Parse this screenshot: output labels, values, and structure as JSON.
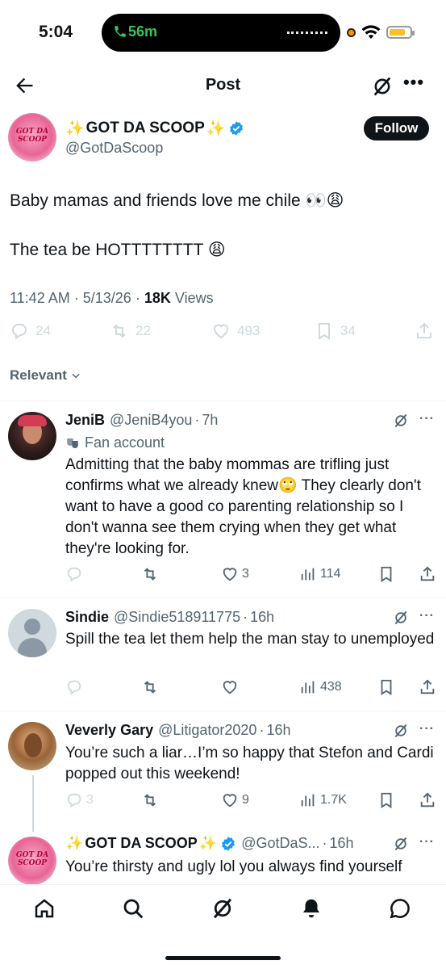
{
  "status_bar": {
    "time": "5:04",
    "call_duration": "56m",
    "battery_percent": 80,
    "accent_call": "#34c759",
    "battery_color": "#f6c026"
  },
  "header": {
    "title": "Post",
    "back_icon": "arrow-left-icon",
    "grok_icon": "grok-icon",
    "more_icon": "more-horizontal-icon"
  },
  "post": {
    "author_name": "GOT DA SCOOP",
    "sparkle": "✨",
    "handle": "@GotDaScoop",
    "avatar_text": "GOT DA SCOOP",
    "follow_label": "Follow",
    "text_line1": "Baby mamas and friends  love me chile 👀😩",
    "text_line2": "The tea be HOTTTTTTTT 😩",
    "time": "11:42 AM",
    "date": "5/13/26",
    "views_count": "18K",
    "views_label": "Views",
    "separator": "·",
    "stats": {
      "replies": "24",
      "reposts": "22",
      "likes": "493",
      "bookmarks": "34"
    }
  },
  "sort": {
    "label": "Relevant"
  },
  "replies": [
    {
      "name": "JeniB",
      "handle": "@JeniB4you",
      "age": "7h",
      "badge": "Fan account",
      "text": "Admitting that the baby mommas are trifling just confirms what we already knew🙄 They clearly don't want to have a good co parenting relationship so I don't wanna see them crying when they get what they're looking for.",
      "likes": "3",
      "views": "114"
    },
    {
      "name": "Sindie",
      "handle": "@Sindie518911775",
      "age": "16h",
      "text": "Spill  the  tea  let  them help  the man stay to unemployed",
      "likes": "",
      "views": "438"
    },
    {
      "name": "Veverly Gary",
      "handle": "@Litigator2020",
      "age": "16h",
      "text": "You’re such a liar…I’m so happy that Stefon and Cardi popped out this weekend!",
      "replies": "3",
      "likes": "9",
      "views": "1.7K"
    },
    {
      "name": "GOT DA SCOOP",
      "handle": "@GotDaS...",
      "age": "16h",
      "text": "You’re thirsty and ugly lol you always find yourself"
    }
  ],
  "icons": {
    "reply": "reply-icon",
    "repost": "repost-icon",
    "like": "heart-icon",
    "views": "views-icon",
    "bookmark": "bookmark-icon",
    "share": "share-icon",
    "verified": "verified-badge-icon"
  },
  "colors": {
    "text": "#0f1419",
    "secondary": "#536471",
    "verified": "#1d9bf0",
    "divider": "#eff3f4"
  }
}
